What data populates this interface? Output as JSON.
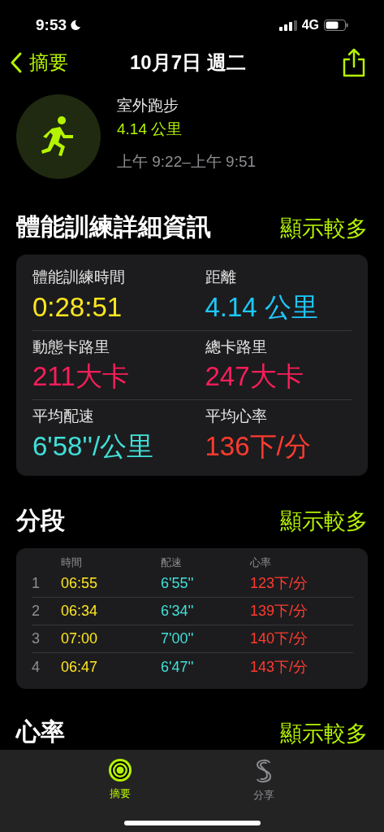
{
  "status_bar": {
    "time": "9:53",
    "network": "4G"
  },
  "nav": {
    "back": "摘要",
    "title": "10月7日 週二"
  },
  "workout": {
    "name": "室外跑步",
    "distance": "4.14 公里",
    "time_range": "上午 9:22–上午 9:51"
  },
  "details": {
    "title": "體能訓練詳細資訊",
    "more": "顯示較多",
    "metrics": [
      {
        "label": "體能訓練時間",
        "value": "0:28:51",
        "color": "#ffe620"
      },
      {
        "label": "距離",
        "value": "4.14 公里",
        "color": "#1ec8fa"
      },
      {
        "label": "動態卡路里",
        "value": "211大卡",
        "color": "#fa1e5a"
      },
      {
        "label": "總卡路里",
        "value": "247大卡",
        "color": "#fa1e5a"
      },
      {
        "label": "平均配速",
        "value": "6'58''/公里",
        "color": "#40e0d8"
      },
      {
        "label": "平均心率",
        "value": "136下/分",
        "color": "#ff3b30"
      }
    ]
  },
  "splits": {
    "title": "分段",
    "more": "顯示較多",
    "columns": [
      "時間",
      "配速",
      "心率"
    ],
    "rows": [
      {
        "index": "1",
        "time": "06:55",
        "pace": "6'55''",
        "heart_rate": "123下/分"
      },
      {
        "index": "2",
        "time": "06:34",
        "pace": "6'34''",
        "heart_rate": "139下/分"
      },
      {
        "index": "3",
        "time": "07:00",
        "pace": "7'00''",
        "heart_rate": "140下/分"
      },
      {
        "index": "4",
        "time": "06:47",
        "pace": "6'47''",
        "heart_rate": "143下/分"
      }
    ]
  },
  "heart_rate": {
    "title": "心率",
    "more": "顯示較多"
  },
  "tab_bar": [
    {
      "label": "摘要",
      "kind": "rings",
      "selected": true
    },
    {
      "label": "分享",
      "kind": "share",
      "selected": false
    }
  ]
}
